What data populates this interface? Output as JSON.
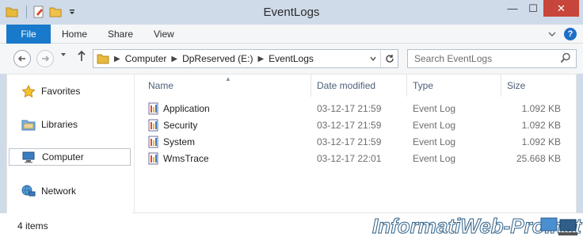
{
  "window": {
    "title": "EventLogs",
    "controls": {
      "minimize": "—",
      "maximize": "☐",
      "close": "✕"
    }
  },
  "ribbon": {
    "tabs": [
      "File",
      "Home",
      "Share",
      "View"
    ],
    "expand_icon": "chevron-down-icon",
    "help_label": "?"
  },
  "navigation": {
    "address": {
      "crumbs": [
        "Computer",
        "DpReserved (E:)",
        "EventLogs"
      ]
    },
    "search_placeholder": "Search EventLogs"
  },
  "nav_pane": {
    "items": [
      {
        "label": "Favorites",
        "icon": "star-icon"
      },
      {
        "label": "Libraries",
        "icon": "libraries-icon"
      },
      {
        "label": "Computer",
        "icon": "computer-icon",
        "selected": true
      },
      {
        "label": "Network",
        "icon": "network-icon"
      }
    ]
  },
  "file_list": {
    "columns": [
      "Name",
      "Date modified",
      "Type",
      "Size"
    ],
    "sorted_column": "Name",
    "rows": [
      {
        "name": "Application",
        "date": "03-12-17 21:59",
        "type": "Event Log",
        "size": "1.092 KB"
      },
      {
        "name": "Security",
        "date": "03-12-17 21:59",
        "type": "Event Log",
        "size": "1.092 KB"
      },
      {
        "name": "System",
        "date": "03-12-17 21:59",
        "type": "Event Log",
        "size": "1.092 KB"
      },
      {
        "name": "WmsTrace",
        "date": "03-12-17 22:01",
        "type": "Event Log",
        "size": "25.668 KB"
      }
    ]
  },
  "status_bar": {
    "item_count": "4 items"
  },
  "watermark": {
    "text": "InformatiWeb-Pro.net"
  },
  "colors": {
    "accent": "#1979ca",
    "close": "#c7453a",
    "frame": "#cfdbe9"
  }
}
